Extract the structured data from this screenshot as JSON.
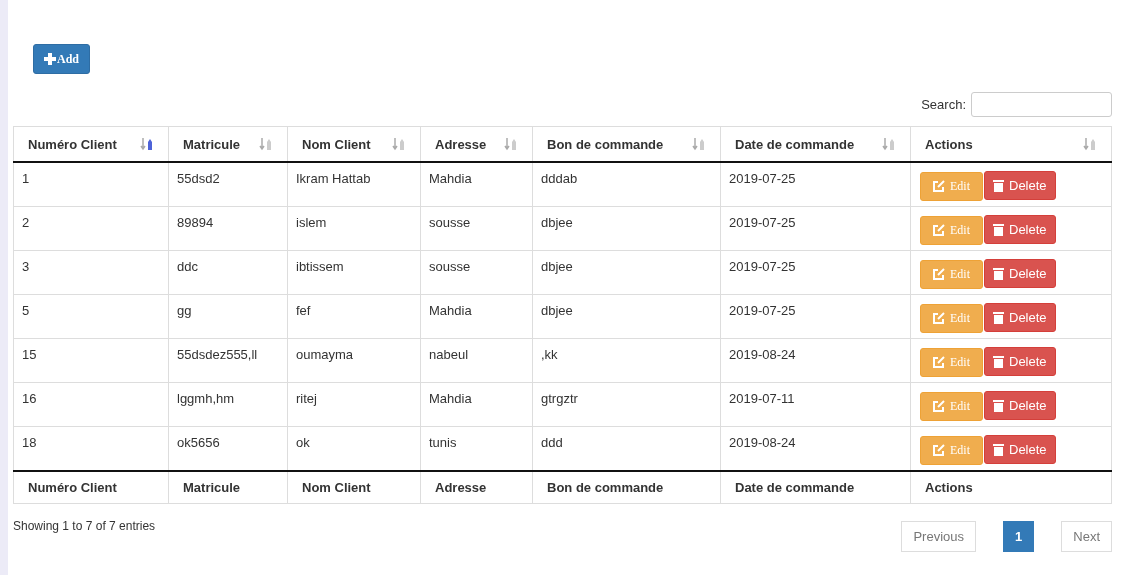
{
  "add_button": {
    "label": "Add"
  },
  "search": {
    "label": "Search:"
  },
  "table": {
    "columns": [
      {
        "label": "Numéro Client",
        "sorted": true
      },
      {
        "label": "Matricule",
        "sorted": false
      },
      {
        "label": "Nom Client",
        "sorted": false
      },
      {
        "label": "Adresse",
        "sorted": false
      },
      {
        "label": "Bon de commande",
        "sorted": false
      },
      {
        "label": "Date de commande",
        "sorted": false
      },
      {
        "label": "Actions",
        "sorted": false
      }
    ],
    "rows": [
      {
        "cells": [
          "1",
          "55dsd2",
          "Ikram Hattab",
          "Mahdia",
          "dddab",
          "2019-07-25"
        ],
        "actions": [
          {
            "kind": "edit",
            "label": "Edit"
          },
          {
            "kind": "delete",
            "label": "Delete"
          }
        ]
      },
      {
        "cells": [
          "2",
          "89894",
          "islem",
          "sousse",
          "dbjee",
          "2019-07-25"
        ],
        "actions": [
          {
            "kind": "edit",
            "label": "Edit"
          },
          {
            "kind": "delete",
            "label": "Delete"
          }
        ]
      },
      {
        "cells": [
          "3",
          "ddc",
          "ibtissem",
          "sousse",
          "dbjee",
          "2019-07-25"
        ],
        "actions": [
          {
            "kind": "edit",
            "label": "Edit"
          },
          {
            "kind": "delete",
            "label": "Delete"
          }
        ]
      },
      {
        "cells": [
          "5",
          "gg",
          "fef",
          "Mahdia",
          "dbjee",
          "2019-07-25"
        ],
        "actions": [
          {
            "kind": "edit",
            "label": "Edit"
          },
          {
            "kind": "delete",
            "label": "Delete"
          }
        ]
      },
      {
        "cells": [
          "15",
          "55dsdez555,ll",
          "oumayma",
          "nabeul",
          ",kk",
          "2019-08-24"
        ],
        "actions": [
          {
            "kind": "edit",
            "label": "Edit"
          },
          {
            "kind": "delete",
            "label": "Delete"
          }
        ]
      },
      {
        "cells": [
          "16",
          "lggmh,hm",
          "ritej",
          "Mahdia",
          "gtrgztr",
          "2019-07-11"
        ],
        "actions": [
          {
            "kind": "edit",
            "label": "Edit"
          },
          {
            "kind": "delete",
            "label": "Delete"
          }
        ]
      },
      {
        "cells": [
          "18",
          "ok5656",
          "ok",
          "tunis",
          "ddd",
          "2019-08-24"
        ],
        "actions": [
          {
            "kind": "edit",
            "label": "Edit"
          },
          {
            "kind": "delete",
            "label": "Delete"
          }
        ]
      }
    ],
    "footer": [
      "Numéro Client",
      "Matricule",
      "Nom Client",
      "Adresse",
      "Bon de commande",
      "Date de commande",
      "Actions"
    ]
  },
  "info": "Showing 1 to 7 of 7 entries",
  "pagination": [
    {
      "label": "Previous",
      "selected": false,
      "disabled": true
    },
    {
      "label": "1",
      "selected": true,
      "disabled": false
    },
    {
      "label": "Next",
      "selected": false,
      "disabled": true
    }
  ]
}
